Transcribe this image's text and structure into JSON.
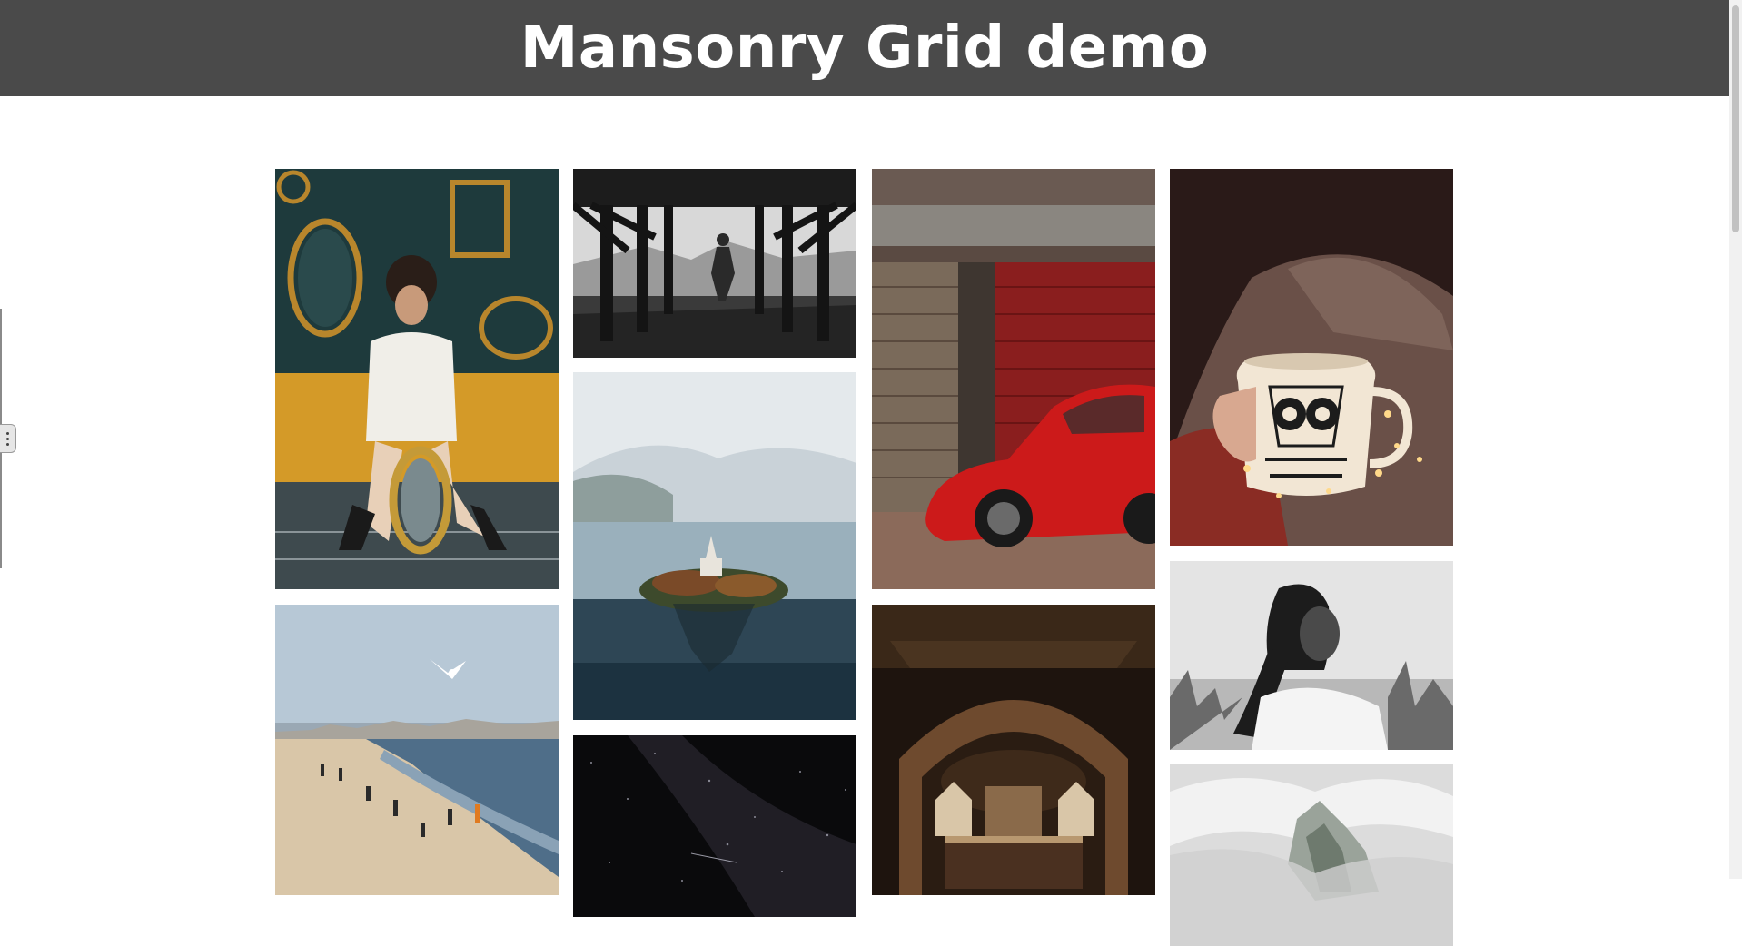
{
  "header": {
    "title": "Mansonry Grid demo"
  },
  "gallery": {
    "columns": [
      {
        "photos": [
          {
            "subject": "woman-with-mirrors",
            "colors": [
              "#173235",
              "#d49a28",
              "#f0eee8"
            ]
          },
          {
            "subject": "beach-with-seagull",
            "colors": [
              "#b7c8d6",
              "#4f6e89",
              "#d9c6a8"
            ]
          }
        ]
      },
      {
        "photos": [
          {
            "subject": "pier-bw",
            "colors": [
              "#1c1c1c",
              "#e6e6e6",
              "#7a7a7a"
            ]
          },
          {
            "subject": "lake-island-church",
            "colors": [
              "#e4e9ec",
              "#2e4655",
              "#7a4a28"
            ]
          },
          {
            "subject": "night-sky-stars",
            "colors": [
              "#0a0a0c",
              "#2a2630",
              "#8a8a96"
            ]
          }
        ]
      },
      {
        "photos": [
          {
            "subject": "red-beetle-car",
            "colors": [
              "#4a3b33",
              "#cc1a1a",
              "#8b6a5a"
            ]
          },
          {
            "subject": "church-dome-interior",
            "colors": [
              "#1e140e",
              "#6e4a2e",
              "#d9c6a8"
            ]
          }
        ]
      },
      {
        "photos": [
          {
            "subject": "owl-mug-fairy-lights",
            "colors": [
              "#2a1a18",
              "#6a5048",
              "#f2e6d4"
            ]
          },
          {
            "subject": "smiling-woman-bw",
            "colors": [
              "#e4e4e4",
              "#1c1c1c",
              "#b8b8b8"
            ]
          },
          {
            "subject": "misty-forest",
            "colors": [
              "#dcdcdc",
              "#9aa39a",
              "#f2f2f2"
            ]
          }
        ]
      }
    ]
  }
}
